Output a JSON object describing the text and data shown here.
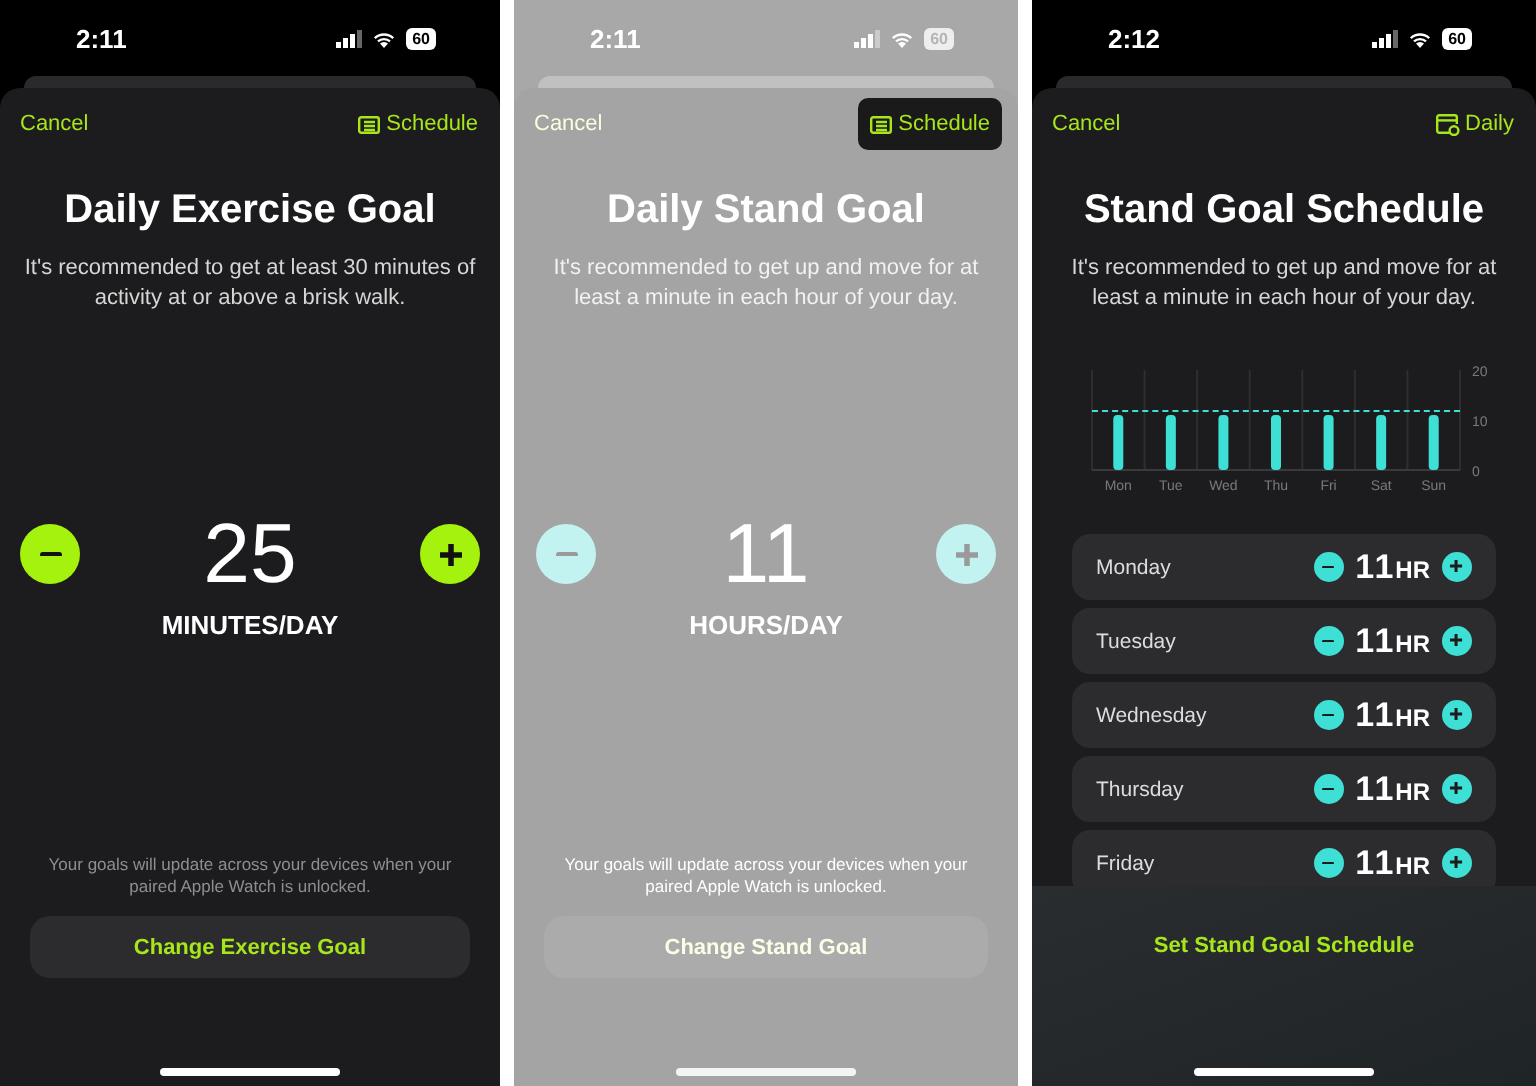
{
  "phones": [
    {
      "kind": "stepper",
      "dimmed": false,
      "status_bar": {
        "time": "2:11",
        "battery": "60"
      },
      "nav": {
        "cancel": "Cancel",
        "action": "Schedule",
        "highlighted": false
      },
      "title": "Daily Exercise Goal",
      "description": "It's recommended to get at least 30 minutes of activity at or above a brisk walk.",
      "stepper": {
        "value": "25",
        "unit": "MINUTES/DAY",
        "color": "#a6f20f"
      },
      "note": "Your goals will update across your devices when your paired Apple Watch is unlocked.",
      "button": "Change Exercise Goal"
    },
    {
      "kind": "stepper",
      "dimmed": true,
      "status_bar": {
        "time": "2:11",
        "battery": "60"
      },
      "nav": {
        "cancel": "Cancel",
        "action": "Schedule",
        "highlighted": true
      },
      "title": "Daily Stand Goal",
      "description": "It's recommended to get up and move for at least a minute in each hour of your day.",
      "stepper": {
        "value": "11",
        "unit": "HOURS/DAY",
        "color": "#c2f3f0"
      },
      "note": "Your goals will update across your devices when your paired Apple Watch is unlocked.",
      "button": "Change Stand Goal"
    },
    {
      "kind": "schedule",
      "dimmed": false,
      "status_bar": {
        "time": "2:12",
        "battery": "60"
      },
      "nav": {
        "cancel": "Cancel",
        "action": "Daily",
        "highlighted": false
      },
      "title": "Stand Goal Schedule",
      "description": "It's recommended to get up and move for at least a minute in each hour of your day.",
      "chart_data": {
        "type": "bar",
        "categories": [
          "Mon",
          "Tue",
          "Wed",
          "Thu",
          "Fri",
          "Sat",
          "Sun"
        ],
        "values": [
          11,
          11,
          11,
          11,
          11,
          11,
          11
        ],
        "ylim": [
          0,
          20
        ],
        "yticks": [
          0,
          10,
          20
        ]
      },
      "days": [
        {
          "day": "Monday",
          "value": "11",
          "unit": "HR"
        },
        {
          "day": "Tuesday",
          "value": "11",
          "unit": "HR"
        },
        {
          "day": "Wednesday",
          "value": "11",
          "unit": "HR"
        },
        {
          "day": "Thursday",
          "value": "11",
          "unit": "HR"
        },
        {
          "day": "Friday",
          "value": "11",
          "unit": "HR"
        }
      ],
      "button": "Set Stand Goal Schedule"
    }
  ]
}
